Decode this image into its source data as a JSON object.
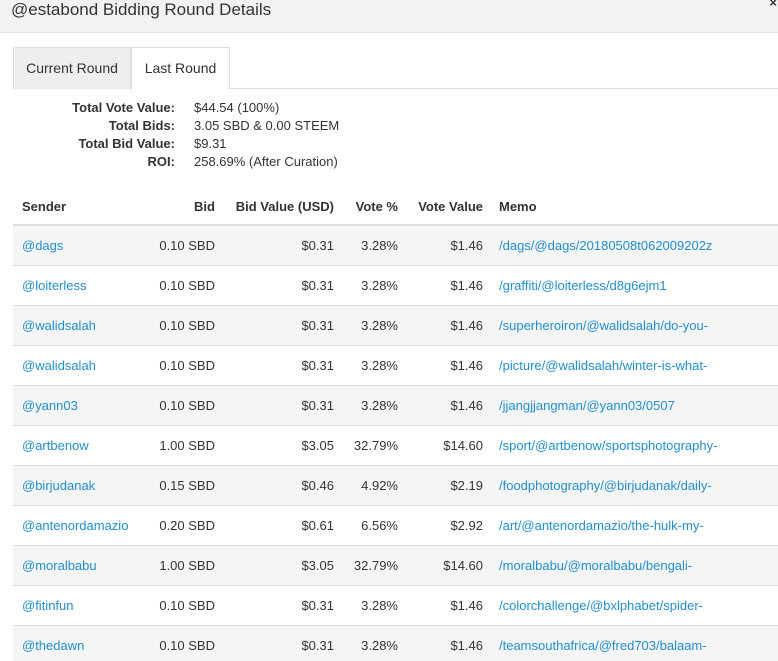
{
  "modal": {
    "title": "@estabond Bidding Round Details",
    "close_glyph": "×"
  },
  "tabs": [
    {
      "label": "Current Round",
      "active": false
    },
    {
      "label": "Last Round",
      "active": true
    }
  ],
  "summary": [
    {
      "label": "Total Vote Value:",
      "value": "$44.54 (100%)"
    },
    {
      "label": "Total Bids:",
      "value": "3.05 SBD & 0.00 STEEM"
    },
    {
      "label": "Total Bid Value:",
      "value": "$9.31"
    },
    {
      "label": "ROI:",
      "value": "258.69% (After Curation)"
    }
  ],
  "table": {
    "headers": [
      "Sender",
      "Bid",
      "Bid Value (USD)",
      "Vote %",
      "Vote Value",
      "Memo"
    ],
    "rows": [
      {
        "sender": "@dags",
        "bid": "0.10 SBD",
        "bid_value": "$0.31",
        "vote_pct": "3.28%",
        "vote_value": "$1.46",
        "memo": "/dags/@dags/20180508t062009202z"
      },
      {
        "sender": "@loiterless",
        "bid": "0.10 SBD",
        "bid_value": "$0.31",
        "vote_pct": "3.28%",
        "vote_value": "$1.46",
        "memo": "/graffiti/@loiterless/d8g6ejm1"
      },
      {
        "sender": "@walidsalah",
        "bid": "0.10 SBD",
        "bid_value": "$0.31",
        "vote_pct": "3.28%",
        "vote_value": "$1.46",
        "memo": "/superheroiron/@walidsalah/do-you-"
      },
      {
        "sender": "@walidsalah",
        "bid": "0.10 SBD",
        "bid_value": "$0.31",
        "vote_pct": "3.28%",
        "vote_value": "$1.46",
        "memo": "/picture/@walidsalah/winter-is-what-"
      },
      {
        "sender": "@yann03",
        "bid": "0.10 SBD",
        "bid_value": "$0.31",
        "vote_pct": "3.28%",
        "vote_value": "$1.46",
        "memo": "/jjangjjangman/@yann03/0507"
      },
      {
        "sender": "@artbenow",
        "bid": "1.00 SBD",
        "bid_value": "$3.05",
        "vote_pct": "32.79%",
        "vote_value": "$14.60",
        "memo": "/sport/@artbenow/sportsphotography-"
      },
      {
        "sender": "@birjudanak",
        "bid": "0.15 SBD",
        "bid_value": "$0.46",
        "vote_pct": "4.92%",
        "vote_value": "$2.19",
        "memo": "/foodphotography/@birjudanak/daily-"
      },
      {
        "sender": "@antenordamazio",
        "bid": "0.20 SBD",
        "bid_value": "$0.61",
        "vote_pct": "6.56%",
        "vote_value": "$2.92",
        "memo": "/art/@antenordamazio/the-hulk-my-"
      },
      {
        "sender": "@moralbabu",
        "bid": "1.00 SBD",
        "bid_value": "$3.05",
        "vote_pct": "32.79%",
        "vote_value": "$14.60",
        "memo": "/moralbabu/@moralbabu/bengali-"
      },
      {
        "sender": "@fitinfun",
        "bid": "0.10 SBD",
        "bid_value": "$0.31",
        "vote_pct": "3.28%",
        "vote_value": "$1.46",
        "memo": "/colorchallenge/@bxlphabet/spider-"
      },
      {
        "sender": "@thedawn",
        "bid": "0.10 SBD",
        "bid_value": "$0.31",
        "vote_pct": "3.28%",
        "vote_value": "$1.46",
        "memo": "/teamsouthafrica/@fred703/balaam-"
      }
    ]
  },
  "colors": {
    "link": "#1e8fd6",
    "header_bg": "#f2f2f2",
    "stripe": "#f5f5f5",
    "border": "#dddddd"
  }
}
